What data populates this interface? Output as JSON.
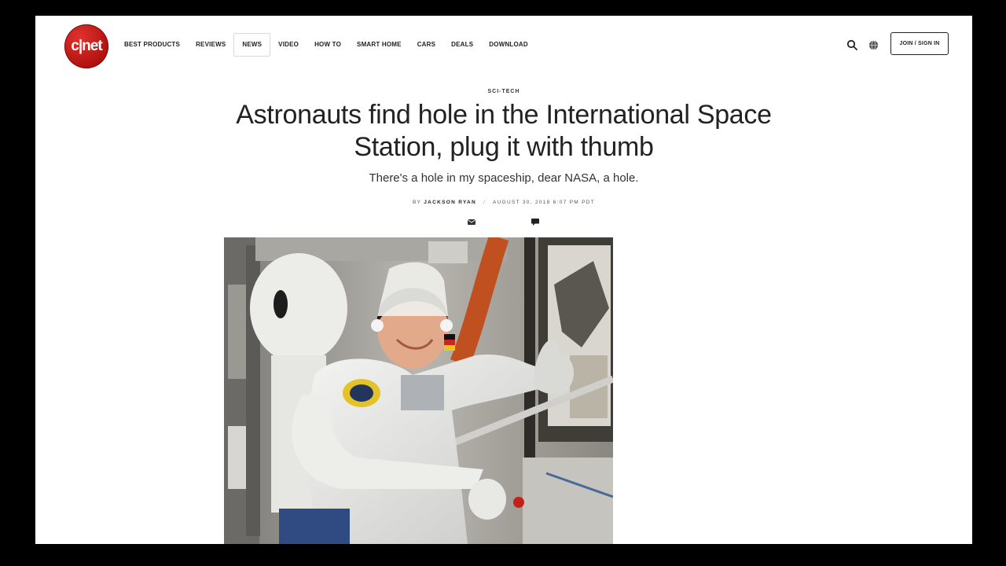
{
  "header": {
    "logo_text": "c|net",
    "nav": [
      {
        "label": "Best Products",
        "active": false
      },
      {
        "label": "Reviews",
        "active": false
      },
      {
        "label": "News",
        "active": true
      },
      {
        "label": "Video",
        "active": false
      },
      {
        "label": "How To",
        "active": false
      },
      {
        "label": "Smart Home",
        "active": false
      },
      {
        "label": "Cars",
        "active": false
      },
      {
        "label": "Deals",
        "active": false
      },
      {
        "label": "Download",
        "active": false
      }
    ],
    "join_label": "Join / Sign In"
  },
  "article": {
    "section": "Sci-Tech",
    "title": "Astronauts find hole in the International Space Station, plug it with thumb",
    "subtitle": "There's a hole in my spaceship, dear NASA, a hole.",
    "by": "By",
    "author": "Jackson Ryan",
    "date": "August 30, 2018 6:07 PM PDT"
  },
  "icons": {
    "search": "search-icon",
    "globe": "globe-icon",
    "email": "email-share-icon",
    "comment": "comment-icon"
  },
  "colors": {
    "brand": "#b3120f",
    "text": "#222222",
    "frame": "#000000"
  }
}
